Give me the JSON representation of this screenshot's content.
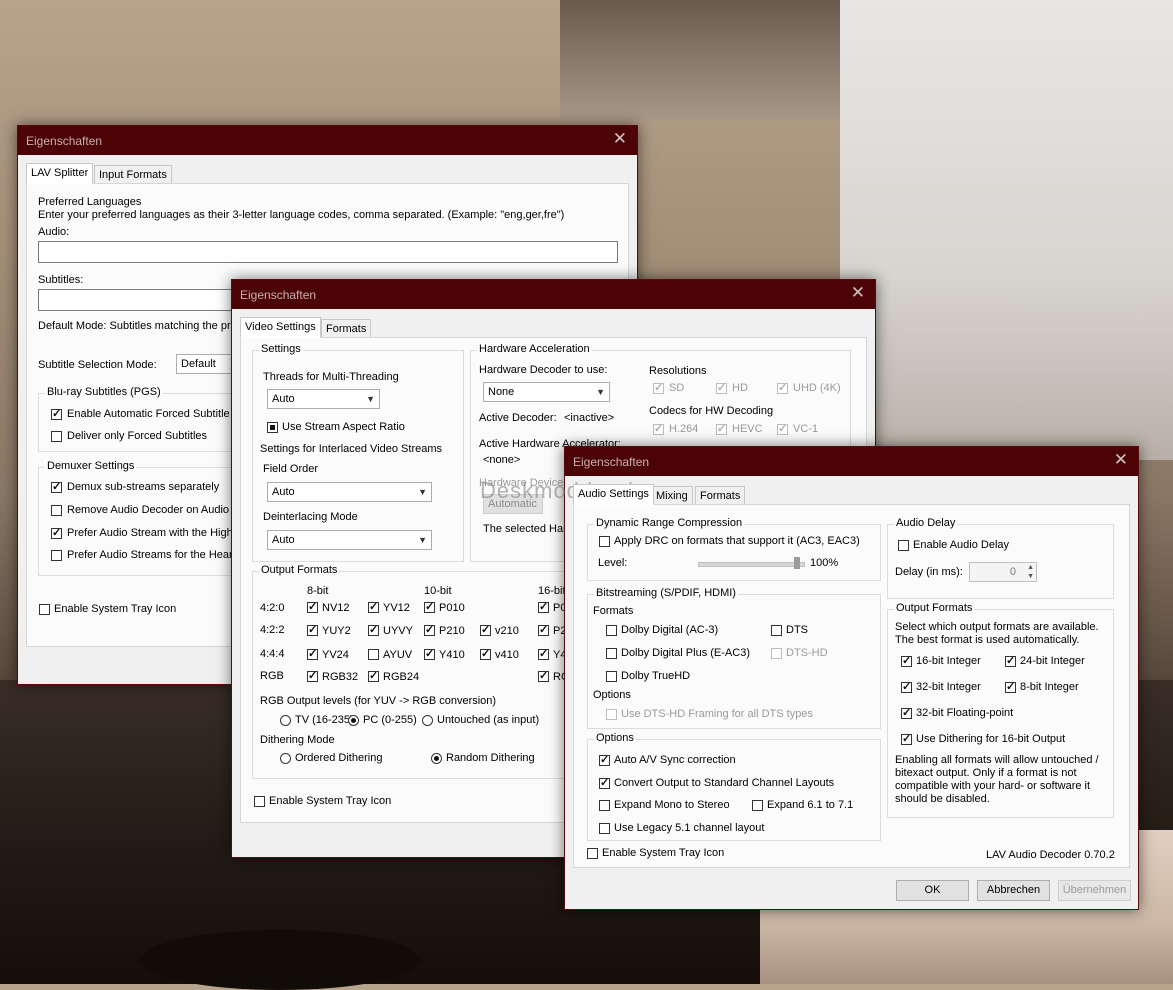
{
  "w1": {
    "title": "Eigenschaften",
    "tabs": [
      "LAV Splitter",
      "Input Formats"
    ],
    "preferred_languages": "Preferred Languages",
    "hint": "Enter your preferred languages as their 3-letter language codes, comma separated. (Example: \"eng,ger,fre\")",
    "audio_label": "Audio:",
    "audio_value": "",
    "subtitles_label": "Subtitles:",
    "default_mode": "Default Mode: Subtitles matching the pre",
    "subtitle_selection_label": "Subtitle Selection Mode:",
    "subtitle_selection_value": "Default",
    "bluray_group": "Blu-ray Subtitles (PGS)",
    "bluray_items": [
      "Enable Automatic Forced Subtitle S",
      "Deliver only Forced Subtitles"
    ],
    "demuxer_group": "Demuxer Settings",
    "demuxer_items": [
      "Demux sub-streams separately",
      "Remove Audio Decoder on Audio S",
      "Prefer Audio Stream with the Highe",
      "Prefer Audio Streams for the Heari"
    ],
    "tray": "Enable System Tray Icon"
  },
  "w2": {
    "title": "Eigenschaften",
    "tabs": [
      "Video Settings",
      "Formats"
    ],
    "settings_group": "Settings",
    "threads_label": "Threads for Multi-Threading",
    "threads_value": "Auto",
    "aspect": "Use Stream Aspect Ratio",
    "interlaced": "Settings for Interlaced Video Streams",
    "field_order_label": "Field Order",
    "field_order_value": "Auto",
    "deint_label": "Deinterlacing Mode",
    "deint_value": "Auto",
    "hw_group": "Hardware Acceleration",
    "hw_decoder_label": "Hardware Decoder to use:",
    "hw_decoder_value": "None",
    "active_decoder": "Active Decoder:",
    "active_decoder_value": "<inactive>",
    "active_hw": "Active Hardware Accelerator:",
    "active_hw_value": "<none>",
    "hw_device": "Hardware Device to",
    "hw_device_value": "Automatic",
    "selected_hw": "The selected Hard",
    "resolutions": "Resolutions",
    "res_items": [
      "SD",
      "HD",
      "UHD (4K)"
    ],
    "codecs": "Codecs for HW Decoding",
    "codec_items": [
      "H.264",
      "HEVC",
      "VC-1"
    ],
    "output_group": "Output Formats",
    "col_heads": [
      "8-bit",
      "10-bit",
      "16-bit"
    ],
    "row_labels": [
      "4:2:0",
      "4:2:2",
      "4:4:4",
      "RGB"
    ],
    "fmt": {
      "nv12": "NV12",
      "yv12": "YV12",
      "p010": "P010",
      "p016": "P016",
      "yuy2": "YUY2",
      "uyvy": "UYVY",
      "p210": "P210",
      "v210": "v210",
      "p216": "P216",
      "yv24": "YV24",
      "ayuv": "AYUV",
      "y410": "Y410",
      "v410": "v410",
      "y416": "Y416",
      "rgb32": "RGB32",
      "rgb24": "RGB24",
      "rgb48": "RGB"
    },
    "rgb_levels": "RGB Output levels (for YUV -> RGB conversion)",
    "levels": [
      "TV (16-235)",
      "PC (0-255)",
      "Untouched (as input)"
    ],
    "dither_label": "Dithering Mode",
    "dither": [
      "Ordered Dithering",
      "Random Dithering"
    ],
    "tray": "Enable System Tray Icon"
  },
  "w3": {
    "title": "Eigenschaften",
    "tabs": [
      "Audio Settings",
      "Mixing",
      "Formats"
    ],
    "drc_group": "Dynamic Range Compression",
    "drc": "Apply DRC on formats that support it (AC3, EAC3)",
    "level_label": "Level:",
    "level_value": "100%",
    "bitstream_group": "Bitstreaming (S/PDIF, HDMI)",
    "formats_label": "Formats",
    "bs_items": [
      "Dolby Digital (AC-3)",
      "DTS",
      "Dolby Digital Plus (E-AC3)",
      "DTS-HD",
      "Dolby TrueHD"
    ],
    "options_label": "Options",
    "dtshd_framing": "Use DTS-HD Framing for all DTS types",
    "options_group": "Options",
    "opt_items": [
      "Auto A/V Sync correction",
      "Convert Output to Standard Channel Layouts",
      "Expand Mono to Stereo",
      "Expand 6.1 to 7.1",
      "Use Legacy 5.1 channel layout"
    ],
    "delay_group": "Audio Delay",
    "enable_delay": "Enable Audio Delay",
    "delay_label": "Delay (in ms):",
    "delay_value": "0",
    "out_group": "Output Formats",
    "out_desc": [
      "Select which output formats are available.",
      "The best format is used automatically."
    ],
    "out_items": [
      "16-bit Integer",
      "24-bit Integer",
      "32-bit Integer",
      "8-bit Integer",
      "32-bit Floating-point",
      "Use Dithering for 16-bit Output"
    ],
    "dither_note": [
      "Enabling all formats will allow untouched /",
      "bitexact output. Only if a format is not",
      "compatible with your hard- or software it",
      "should be disabled."
    ],
    "tray": "Enable System Tray Icon",
    "version": "LAV Audio Decoder 0.70.2",
    "ok": "OK",
    "cancel": "Abbrechen",
    "apply": "Übernehmen"
  },
  "watermark": "Deskmodder.de"
}
